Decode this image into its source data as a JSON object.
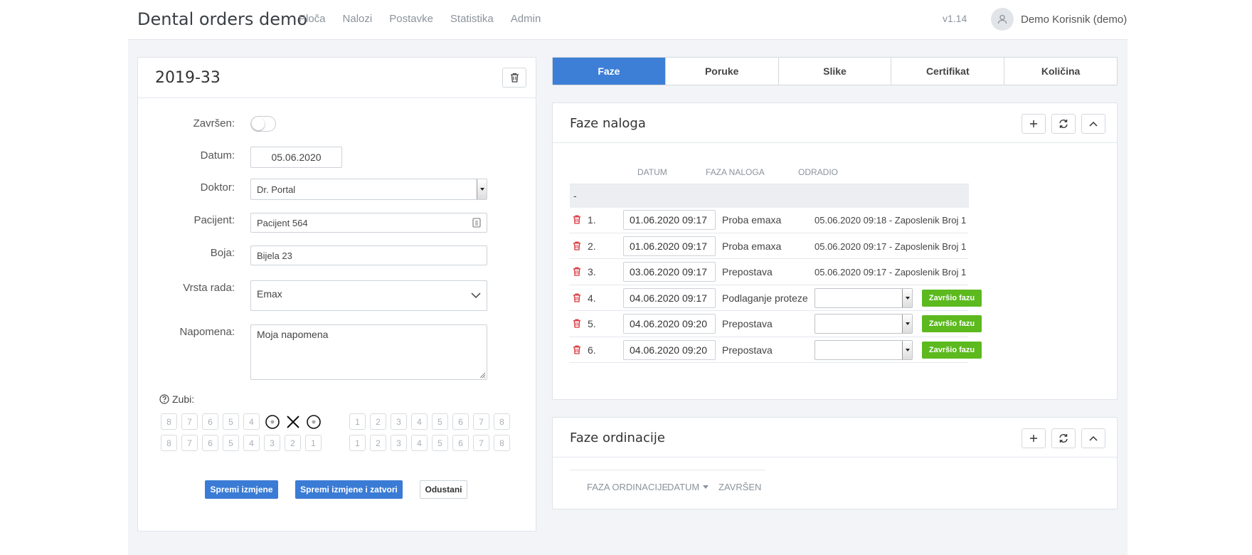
{
  "header": {
    "brand": "Dental orders demo",
    "nav": [
      "Ploča",
      "Nalozi",
      "Postavke",
      "Statistika",
      "Admin"
    ],
    "version": "v1.14",
    "user": "Demo Korisnik (demo)"
  },
  "order": {
    "title": "2019-33",
    "fields": {
      "zavrsen_label": "Završen:",
      "zavrsen_on": false,
      "datum_label": "Datum:",
      "datum_value": "05.06.2020",
      "doktor_label": "Doktor:",
      "doktor_value": "Dr. Portal",
      "pacijent_label": "Pacijent:",
      "pacijent_value": "Pacijent 564",
      "boja_label": "Boja:",
      "boja_value": "Bijela 23",
      "vrsta_label": "Vrsta rada:",
      "vrsta_value": "Emax",
      "napomena_label": "Napomena:",
      "napomena_value": "Moja napomena"
    },
    "zubi_label": "Zubi:",
    "teeth": {
      "upper_left": [
        "8",
        "7",
        "6",
        "5",
        "4",
        "",
        "",
        ""
      ],
      "upper_right": [
        "1",
        "2",
        "3",
        "4",
        "5",
        "6",
        "7",
        "8"
      ],
      "lower_left": [
        "8",
        "7",
        "6",
        "5",
        "4",
        "3",
        "2",
        "1"
      ],
      "lower_right": [
        "1",
        "2",
        "3",
        "4",
        "5",
        "6",
        "7",
        "8"
      ]
    },
    "buttons": {
      "save": "Spremi izmjene",
      "save_close": "Spremi izmjene i zatvori",
      "cancel": "Odustani"
    }
  },
  "tabs": [
    {
      "label": "Faze",
      "active": true
    },
    {
      "label": "Poruke",
      "active": false
    },
    {
      "label": "Slike",
      "active": false
    },
    {
      "label": "Certifikat",
      "active": false
    },
    {
      "label": "Količina",
      "active": false
    }
  ],
  "faze_naloga": {
    "title": "Faze naloga",
    "columns": [
      "DATUM",
      "FAZA NALOGA",
      "ODRADIO"
    ],
    "group": "-",
    "complete_label": "Završio fazu",
    "rows": [
      {
        "num": "1.",
        "date": "01.06.2020 09:17",
        "phase": "Proba emaxa",
        "done_by": "05.06.2020 09:18 - Zaposlenik Broj 1"
      },
      {
        "num": "2.",
        "date": "01.06.2020 09:17",
        "phase": "Proba emaxa",
        "done_by": "05.06.2020 09:17 - Zaposlenik Broj 1"
      },
      {
        "num": "3.",
        "date": "03.06.2020 09:17",
        "phase": "Prepostava",
        "done_by": "05.06.2020 09:17 - Zaposlenik Broj 1"
      },
      {
        "num": "4.",
        "date": "04.06.2020 09:17",
        "phase": "Podlaganje proteze",
        "done_by": ""
      },
      {
        "num": "5.",
        "date": "04.06.2020 09:20",
        "phase": "Prepostava",
        "done_by": ""
      },
      {
        "num": "6.",
        "date": "04.06.2020 09:20",
        "phase": "Prepostava",
        "done_by": ""
      }
    ]
  },
  "faze_ordinacije": {
    "title": "Faze ordinacije",
    "columns": [
      "FAZA ORDINACIJE",
      "DATUM",
      "ZAVRŠEN"
    ]
  },
  "colors": {
    "accent": "#3d7fd6",
    "success": "#5cb91e",
    "danger": "#d9363e"
  }
}
